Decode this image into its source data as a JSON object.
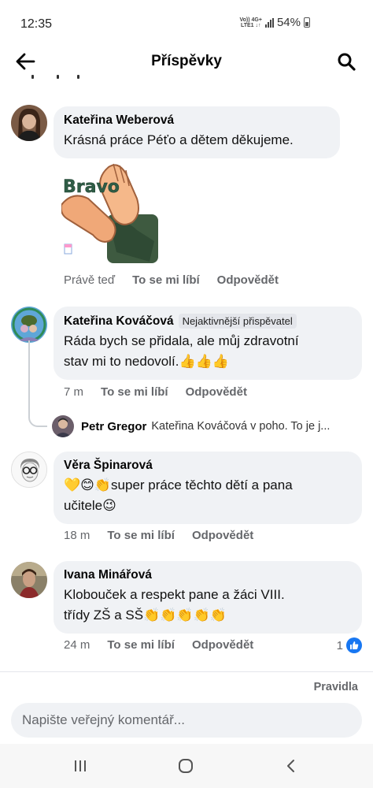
{
  "status": {
    "time": "12:35",
    "net_top": "Vo)) 4G+",
    "net_bottom": "LTE1 ↓↑",
    "battery": "54%"
  },
  "header": {
    "title": "Příspěvky"
  },
  "comments": [
    {
      "author": "Kateřina Weberová",
      "badge": "",
      "text": "Krásná práce Péťo a dětem děkujeme.",
      "sticker_text": "Bravo",
      "time": "Právě teď",
      "like_label": "To se mi líbí",
      "reply_label": "Odpovědět"
    },
    {
      "author": "Kateřina Kováčová",
      "badge": "Nejaktivnější přispěvatel",
      "text_line1": "Ráda bych se přidala, ale můj zdravotní",
      "text_line2": "stav mi to nedovolí.👍👍👍",
      "time": "7 m",
      "like_label": "To se mi líbí",
      "reply_label": "Odpovědět"
    },
    {
      "author": "Věra Špinarová",
      "badge": "",
      "text_line1": "💛😊👏super práce těchto dětí a pana",
      "text_line2": "učitele😉",
      "time": "18 m",
      "like_label": "To se mi líbí",
      "reply_label": "Odpovědět"
    },
    {
      "author": "Ivana Minářová",
      "badge": "",
      "text_line1": "Klobouček a respekt pane a žáci VIII.",
      "text_line2": "třídy ZŠ a SŠ👏👏👏👏👏",
      "time": "24 m",
      "like_label": "To se mi líbí",
      "reply_label": "Odpovědět",
      "reaction_count": "1"
    }
  ],
  "reply": {
    "author": "Petr Gregor",
    "text": "Kateřina Kováčová v poho. To je j..."
  },
  "footer": {
    "rules_label": "Pravidla",
    "composer_placeholder": "Napište veřejný komentář..."
  },
  "colors": {
    "accent": "#1877f2",
    "bubble": "#f0f2f5",
    "meta": "#65676b"
  }
}
